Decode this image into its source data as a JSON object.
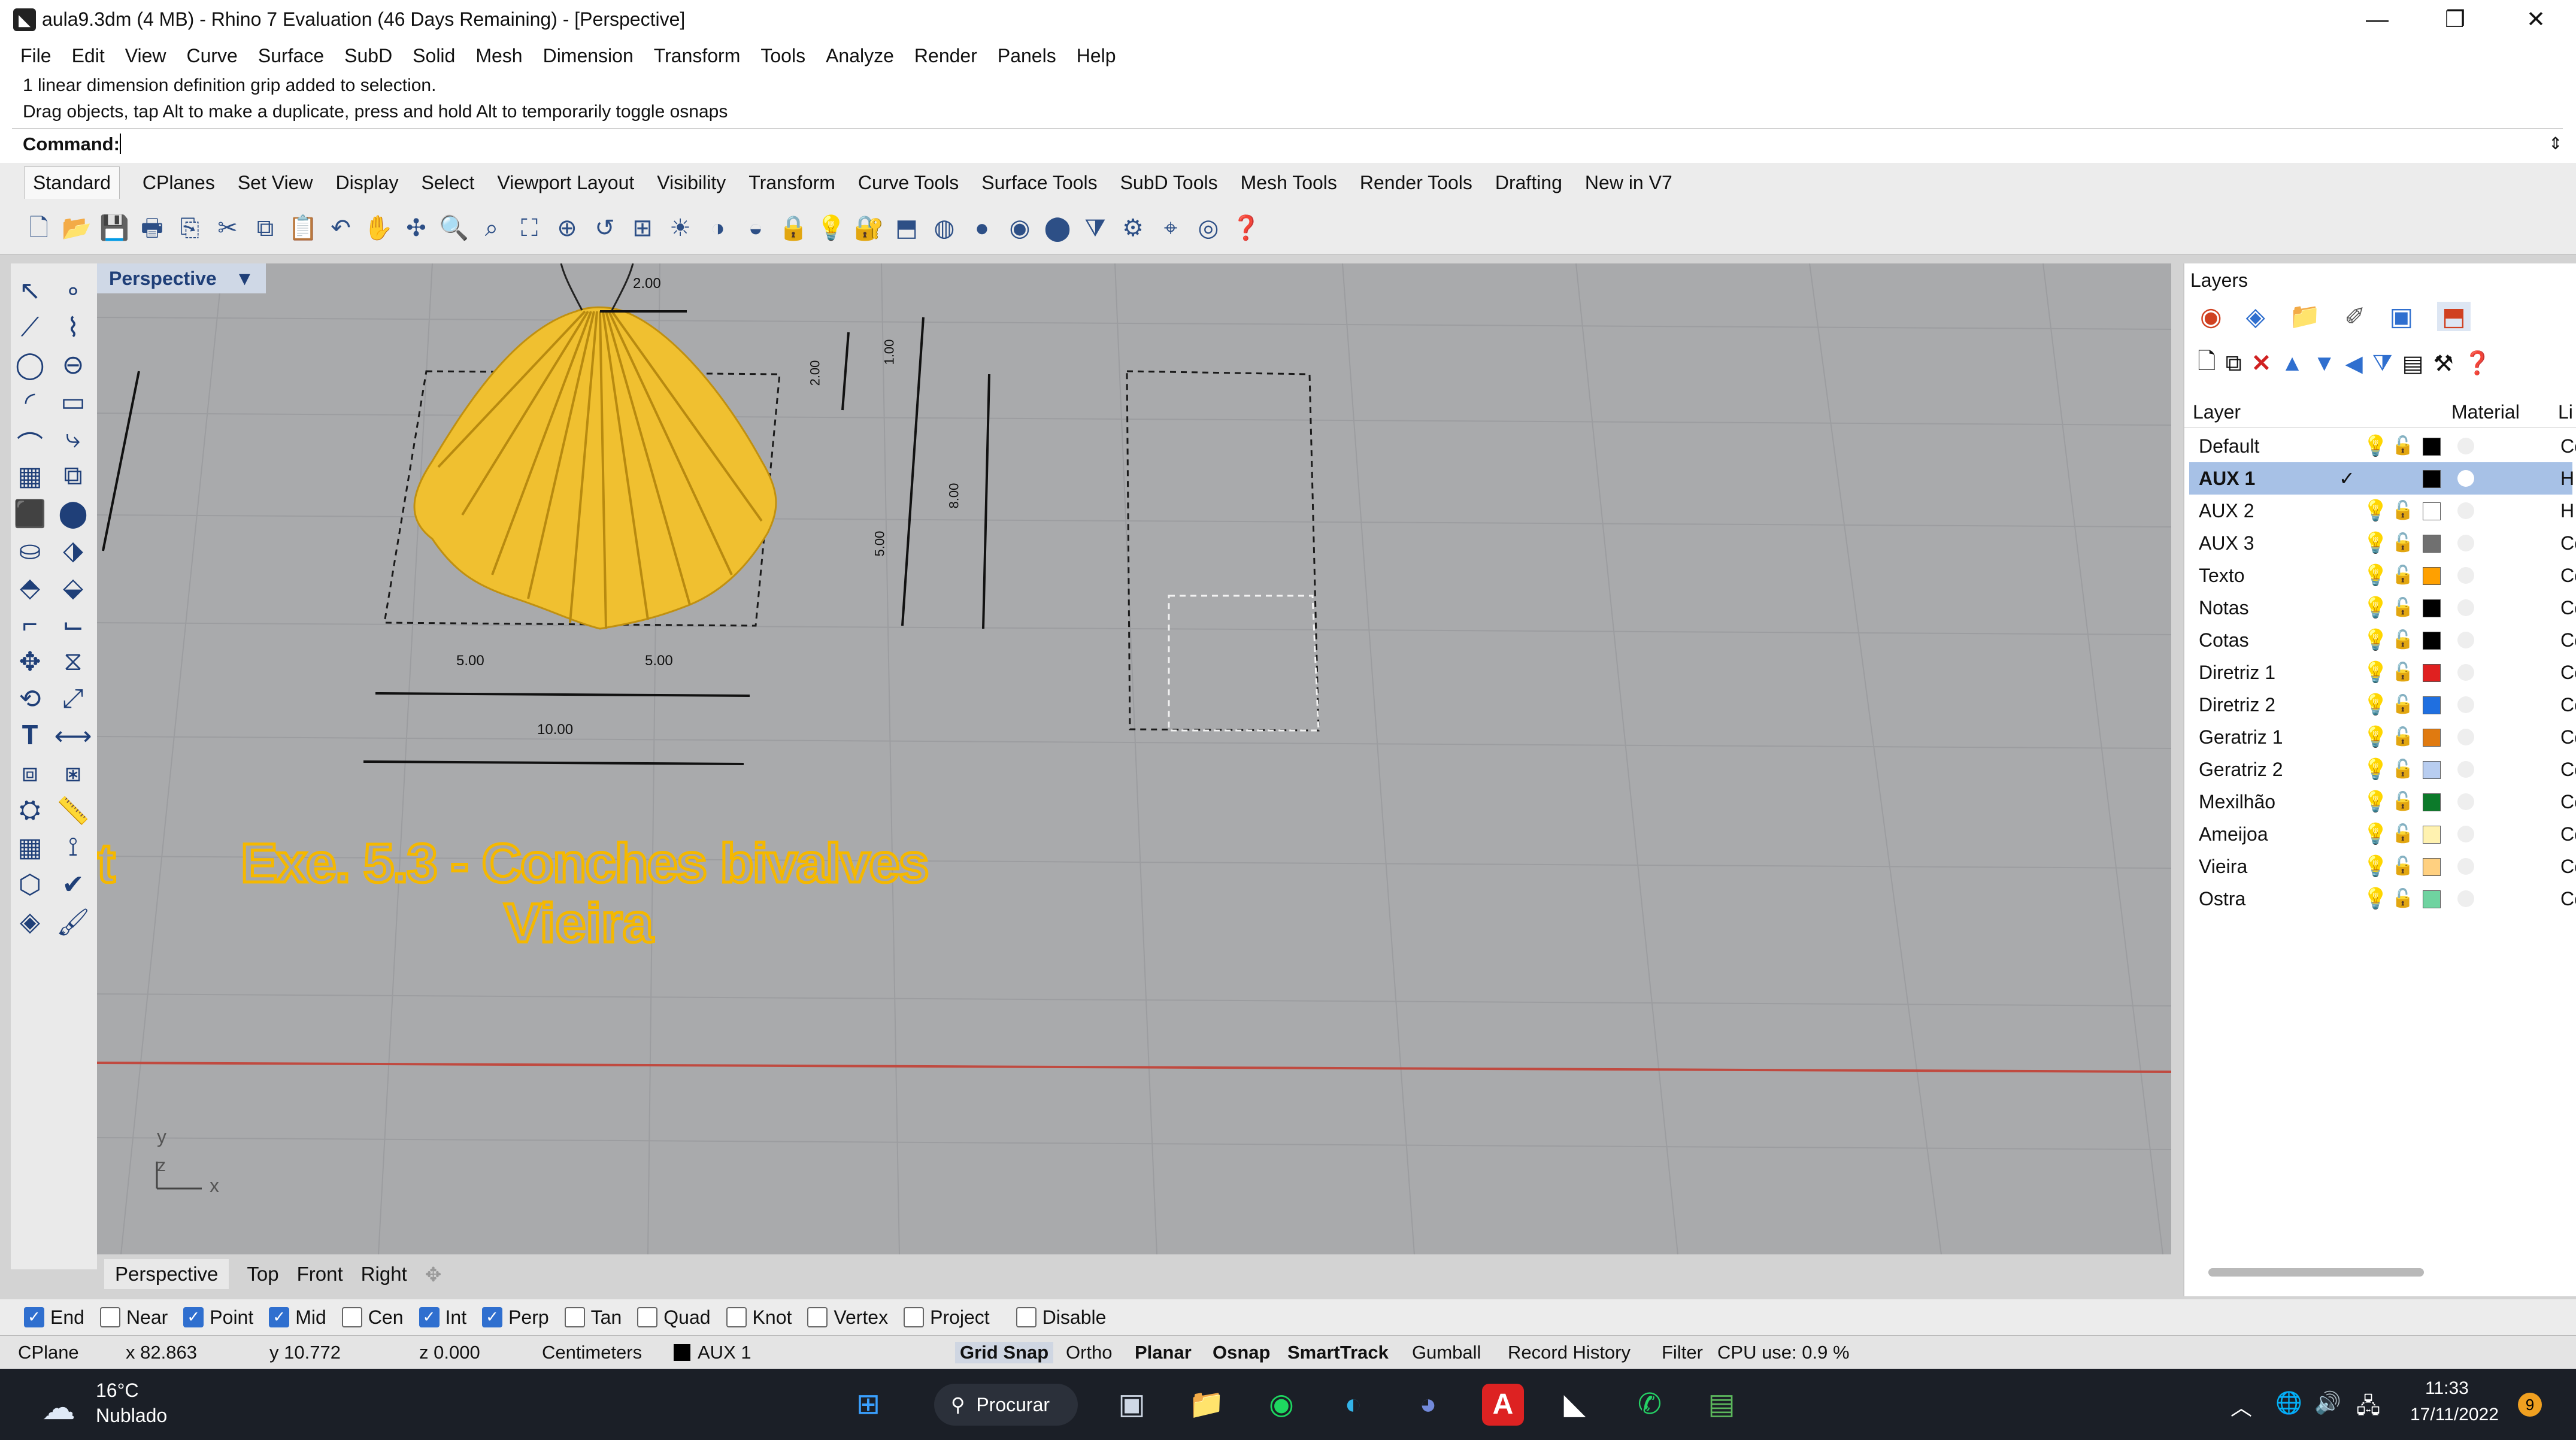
{
  "title_bar": {
    "title": "aula9.3dm (4 MB) - Rhino 7 Evaluation (46 Days Remaining) - [Perspective]",
    "minimize": "—",
    "restore": "❐",
    "close": "✕"
  },
  "menu": [
    "File",
    "Edit",
    "View",
    "Curve",
    "Surface",
    "SubD",
    "Solid",
    "Mesh",
    "Dimension",
    "Transform",
    "Tools",
    "Analyze",
    "Render",
    "Panels",
    "Help"
  ],
  "command": {
    "line1": "1 linear dimension definition grip added to selection.",
    "line2": "Drag objects, tap Alt to make a duplicate, press and hold Alt to temporarily toggle osnaps",
    "prompt": "Command:",
    "value": ""
  },
  "toolbar_tabs": [
    "Standard",
    "CPlanes",
    "Set View",
    "Display",
    "Select",
    "Viewport Layout",
    "Visibility",
    "Transform",
    "Curve Tools",
    "Surface Tools",
    "SubD Tools",
    "Mesh Tools",
    "Render Tools",
    "Drafting",
    "New in V7"
  ],
  "viewport": {
    "label": "Perspective",
    "dropdown": "▼",
    "dims": {
      "top_width": "2.00",
      "vert_a": "2.00",
      "vert_b": "1.00",
      "vert_c": "8.00",
      "vert_d": "5.00",
      "half_left": "5.00",
      "half_right": "5.00",
      "total": "10.00"
    },
    "text_line1": "Exe. 5.3 - Conches bivalves",
    "text_line2": "Vieira",
    "axis_y": "y",
    "axis_z": "z",
    "axis_x": "x",
    "text_fragment": "t"
  },
  "view_tabs": [
    "Perspective",
    "Top",
    "Front",
    "Right"
  ],
  "view_tab_add": "✥",
  "layers_panel": {
    "title": "Layers",
    "col_layer": "Layer",
    "col_material": "Material",
    "col_linetype": "Li",
    "rows": [
      {
        "name": "Default",
        "color": "#000000",
        "lt": "Cc",
        "selected": false
      },
      {
        "name": "AUX 1",
        "color": "#000000",
        "lt": "H",
        "selected": true,
        "current": "✓"
      },
      {
        "name": "AUX 2",
        "color": "#ffffff",
        "lt": "H",
        "selected": false
      },
      {
        "name": "AUX 3",
        "color": "#707070",
        "lt": "Cc",
        "selected": false
      },
      {
        "name": "Texto",
        "color": "#ffa000",
        "lt": "Cc",
        "selected": false
      },
      {
        "name": "Notas",
        "color": "#000000",
        "lt": "Cc",
        "selected": false
      },
      {
        "name": "Cotas",
        "color": "#000000",
        "lt": "Cc",
        "selected": false
      },
      {
        "name": "Diretriz 1",
        "color": "#e02020",
        "lt": "Cc",
        "selected": false
      },
      {
        "name": "Diretriz 2",
        "color": "#1f6fe0",
        "lt": "Cc",
        "selected": false
      },
      {
        "name": "Geratriz 1",
        "color": "#e07a10",
        "lt": "Cc",
        "selected": false
      },
      {
        "name": "Geratriz 2",
        "color": "#b8cdf0",
        "lt": "Cc",
        "selected": false
      },
      {
        "name": "Mexilhão",
        "color": "#0c7a2a",
        "lt": "Cc",
        "selected": false
      },
      {
        "name": "Ameijoa",
        "color": "#fff2b0",
        "lt": "Cc",
        "selected": false
      },
      {
        "name": "Vieira",
        "color": "#ffd080",
        "lt": "Cc",
        "selected": false
      },
      {
        "name": "Ostra",
        "color": "#6fd3a0",
        "lt": "Cc",
        "selected": false
      }
    ]
  },
  "osnaps": [
    {
      "label": "End",
      "on": true
    },
    {
      "label": "Near",
      "on": false
    },
    {
      "label": "Point",
      "on": true
    },
    {
      "label": "Mid",
      "on": true
    },
    {
      "label": "Cen",
      "on": false
    },
    {
      "label": "Int",
      "on": true
    },
    {
      "label": "Perp",
      "on": true
    },
    {
      "label": "Tan",
      "on": false
    },
    {
      "label": "Quad",
      "on": false
    },
    {
      "label": "Knot",
      "on": false
    },
    {
      "label": "Vertex",
      "on": false
    },
    {
      "label": "Project",
      "on": false
    },
    {
      "label": "Disable",
      "on": false
    }
  ],
  "status": {
    "cplane": "CPlane",
    "x": "x 82.863",
    "y": "y 10.772",
    "z": "z 0.000",
    "units": "Centimeters",
    "layer": "AUX 1",
    "grid_snap": "Grid Snap",
    "ortho": "Ortho",
    "planar": "Planar",
    "osnap": "Osnap",
    "smarttrack": "SmartTrack",
    "gumball": "Gumball",
    "record_history": "Record History",
    "filter": "Filter",
    "cpu": "CPU use: 0.9 %"
  },
  "taskbar": {
    "temp": "16°C",
    "weather": "Nublado",
    "search": "Procurar",
    "time": "11:33",
    "date": "17/11/2022",
    "notif": "9"
  },
  "colors": {
    "accent": "#2f6fcf",
    "shell": "#f0c030",
    "text_orange": "#f5b800",
    "selected_row": "#a7c1e6"
  }
}
